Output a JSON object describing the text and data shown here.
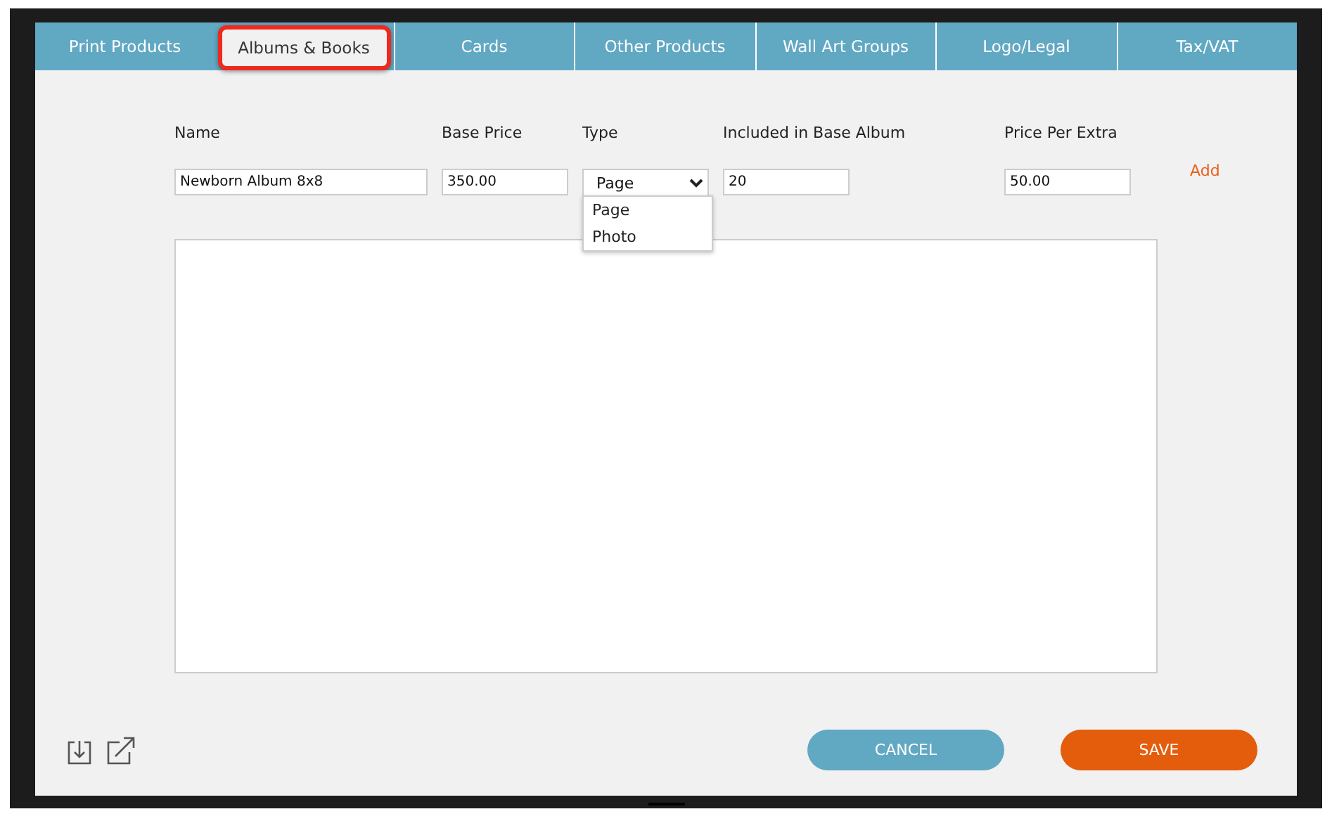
{
  "tabs": [
    {
      "label": "Print Products",
      "selected": false
    },
    {
      "label": "Albums & Books",
      "selected": true
    },
    {
      "label": "Cards",
      "selected": false
    },
    {
      "label": "Other Products",
      "selected": false
    },
    {
      "label": "Wall Art Groups",
      "selected": false
    },
    {
      "label": "Logo/Legal",
      "selected": false
    },
    {
      "label": "Tax/VAT",
      "selected": false
    }
  ],
  "form": {
    "fields": [
      {
        "kind": "text",
        "label": "Name",
        "value": "Newborn Album 8x8"
      },
      {
        "kind": "text",
        "label": "Base Price",
        "value": "350.00"
      },
      {
        "kind": "select",
        "label": "Type",
        "value": "Page",
        "options": [
          "Page",
          "Photo"
        ]
      },
      {
        "kind": "text",
        "label": "Included in Base Album",
        "value": "20"
      },
      {
        "kind": "text",
        "label": "Price Per Extra",
        "value": "50.00"
      }
    ],
    "add_link": "Add"
  },
  "buttons": {
    "cancel": "CANCEL",
    "save": "SAVE"
  }
}
